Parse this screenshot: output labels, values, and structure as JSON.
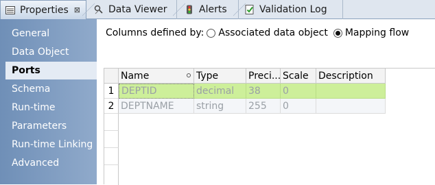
{
  "tabs": [
    {
      "label": "Properties",
      "icon": "properties-icon",
      "active": true,
      "close": "⊠"
    },
    {
      "label": "Data Viewer",
      "icon": "data-viewer-icon",
      "active": false
    },
    {
      "label": "Alerts",
      "icon": "alerts-icon",
      "active": false
    },
    {
      "label": "Validation Log",
      "icon": "validation-log-icon",
      "active": false
    }
  ],
  "sidebar": {
    "items": [
      {
        "label": "General"
      },
      {
        "label": "Data Object"
      },
      {
        "label": "Ports",
        "selected": true
      },
      {
        "label": "Schema"
      },
      {
        "label": "Run-time"
      },
      {
        "label": "Parameters"
      },
      {
        "label": "Run-time Linking"
      },
      {
        "label": "Advanced"
      }
    ]
  },
  "columns_defined_by": {
    "label": "Columns defined by:",
    "options": [
      {
        "label": "Associated data object",
        "checked": false
      },
      {
        "label": "Mapping flow",
        "checked": true
      }
    ]
  },
  "grid": {
    "headers": [
      "Name",
      "Type",
      "Preci...",
      "Scale",
      "Description"
    ],
    "rows": [
      {
        "num": "1",
        "cells": [
          "DEPTID",
          "decimal",
          "38",
          "0",
          ""
        ]
      },
      {
        "num": "2",
        "cells": [
          "DEPTNAME",
          "string",
          "255",
          "0",
          ""
        ]
      }
    ]
  },
  "colors": {
    "sidebar": "#7f9cc2",
    "selected_row": "#cdef9a",
    "tab_strip": "#dfe6ef"
  }
}
